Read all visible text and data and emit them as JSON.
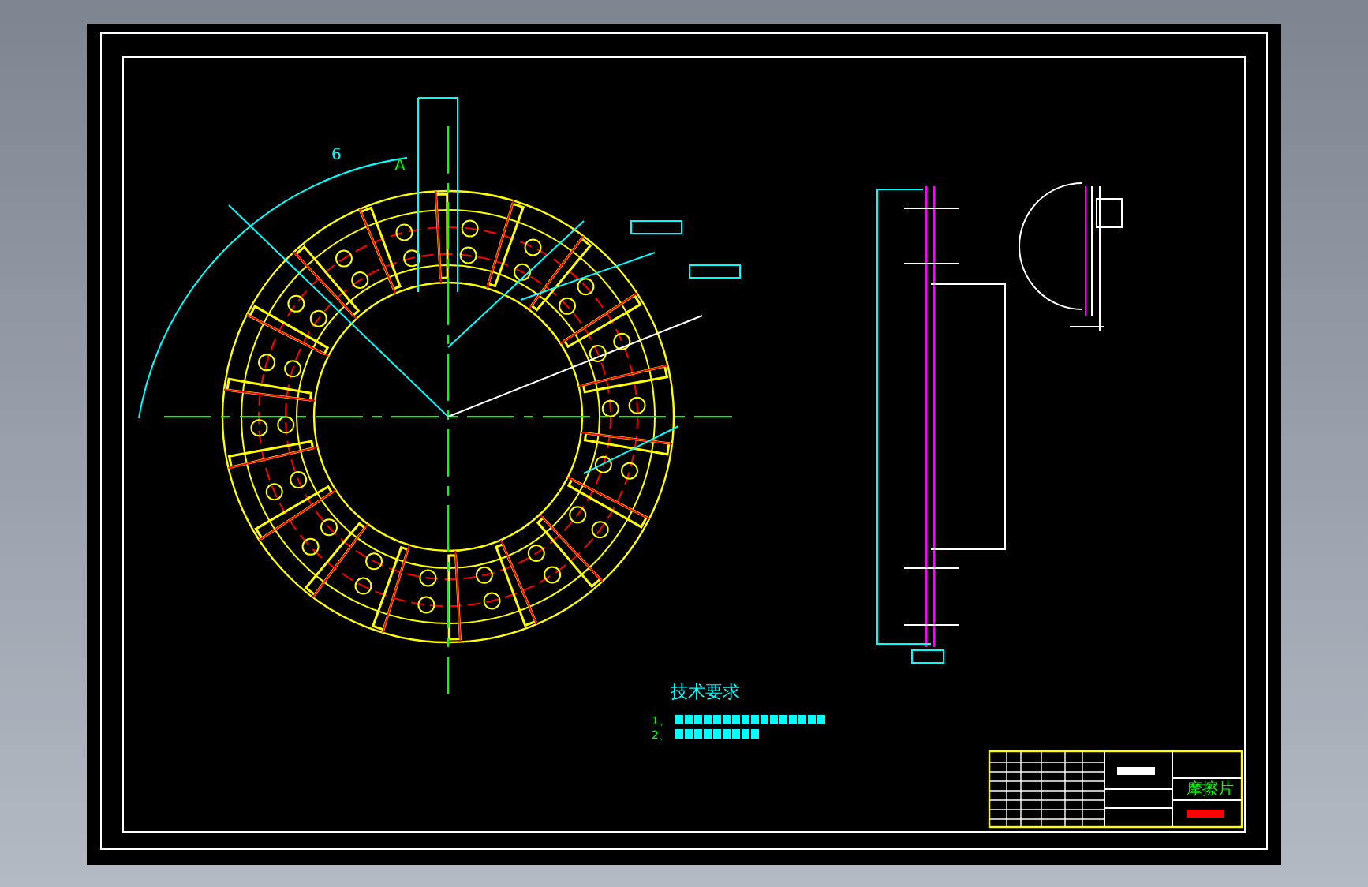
{
  "drawing": {
    "technical_requirements": {
      "title": "技术要求",
      "items": [
        {
          "number": "1",
          "separator": "、"
        },
        {
          "number": "2",
          "separator": "、"
        }
      ]
    },
    "title_block": {
      "part_name": "摩擦片"
    },
    "labels": [
      {
        "text": "A"
      },
      {
        "text": "6"
      }
    ]
  }
}
